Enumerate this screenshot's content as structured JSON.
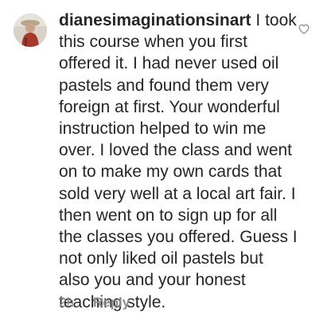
{
  "comment": {
    "username": "dianesimaginationsinart",
    "text": "I took this course when you first offered it. I had never used oil pastels and found them very foreign at first. Your wonderful instruction helped to win me over. I loved the class and went on to make my own cards that sold very well at a local art fair. I then went on to sign up for all the classes you offered.  Guess I not only liked oil pastels but also you and your honest teaching style.",
    "timestamp": "2h",
    "reply_label": "Reply"
  },
  "icons": {
    "like": "heart-outline-icon",
    "avatar": "user-avatar"
  },
  "colors": {
    "text": "#262626",
    "muted": "#8e8e8e"
  }
}
